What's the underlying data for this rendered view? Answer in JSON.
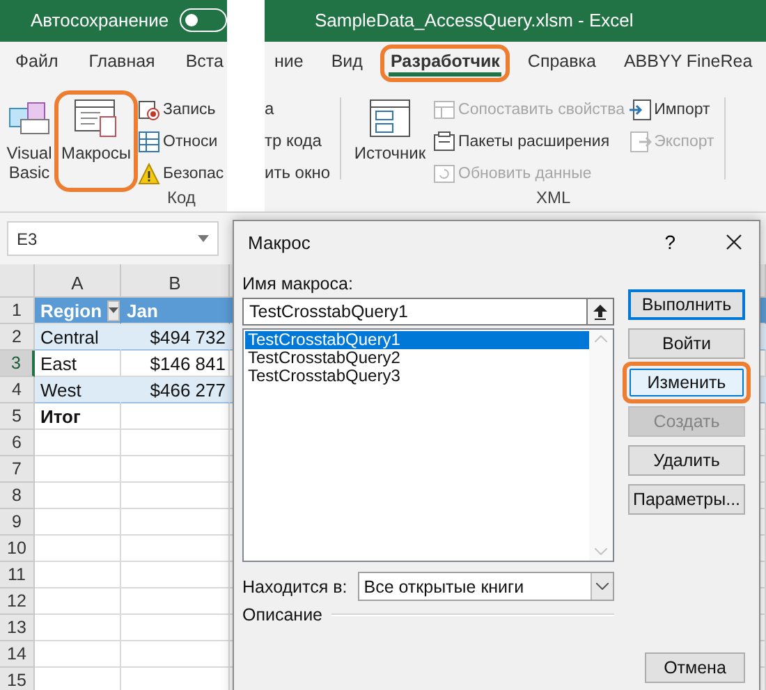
{
  "title_bar": {
    "autosave_label": "Автосохранение",
    "autosave_on": false,
    "title": "SampleData_AccessQuery.xlsm - Excel"
  },
  "tabs_left": [
    {
      "label": "Файл",
      "selected": false,
      "highlighted": false
    },
    {
      "label": "Главная",
      "selected": false,
      "highlighted": false
    },
    {
      "label": "Вста",
      "selected": false,
      "highlighted": false
    }
  ],
  "tabs_right": [
    {
      "label": "ние",
      "selected": false,
      "highlighted": false
    },
    {
      "label": "Вид",
      "selected": false,
      "highlighted": false
    },
    {
      "label": "Разработчик",
      "selected": true,
      "highlighted": true
    },
    {
      "label": "Справка",
      "selected": false,
      "highlighted": false
    },
    {
      "label": "ABBYY FineRea",
      "selected": false,
      "highlighted": false
    }
  ],
  "ribbon_left": {
    "large": [
      {
        "kind": "vb",
        "label": "Visual Basic",
        "highlighted": false
      },
      {
        "kind": "macros",
        "label": "Макросы",
        "highlighted": true
      }
    ],
    "small": [
      {
        "kind": "record",
        "label": "Запись"
      },
      {
        "kind": "relative",
        "label": "Относи"
      },
      {
        "kind": "security",
        "label": "Безопас"
      }
    ],
    "group_label": "Код"
  },
  "ribbon_right": {
    "fragments": [
      "а",
      "тр кода",
      "ить окно"
    ],
    "large": {
      "kind": "source",
      "label": "Источник"
    },
    "column_1": [
      {
        "kind": "map",
        "label": "Сопоставить свойства",
        "disabled": true
      },
      {
        "kind": "pack",
        "label": "Пакеты расширения",
        "disabled": false
      },
      {
        "kind": "refresh",
        "label": "Обновить данные",
        "disabled": true
      }
    ],
    "column_2": [
      {
        "kind": "import",
        "label": "Импорт",
        "disabled": false
      },
      {
        "kind": "export",
        "label": "Экспорт",
        "disabled": true
      }
    ],
    "group_label": "XML"
  },
  "sheet": {
    "name_box": "E3",
    "columns": [
      "A",
      "B"
    ],
    "rows": [
      {
        "number": "1",
        "selected": false,
        "kind": "header",
        "filter": true,
        "cells": [
          "Region",
          "Jan"
        ]
      },
      {
        "number": "2",
        "selected": false,
        "kind": "band",
        "cells": [
          "Central",
          "$494 732"
        ]
      },
      {
        "number": "3",
        "selected": true,
        "kind": "plain",
        "cells": [
          "East",
          "$146 841"
        ]
      },
      {
        "number": "4",
        "selected": false,
        "kind": "band",
        "cells": [
          "West",
          "$466 277"
        ]
      },
      {
        "number": "5",
        "selected": false,
        "kind": "total",
        "cells": [
          "Итог"
        ]
      },
      {
        "number": "6",
        "selected": false,
        "kind": "plain",
        "cells": []
      },
      {
        "number": "7",
        "selected": false,
        "kind": "plain",
        "cells": []
      },
      {
        "number": "8",
        "selected": false,
        "kind": "plain",
        "cells": []
      },
      {
        "number": "9",
        "selected": false,
        "kind": "plain",
        "cells": []
      },
      {
        "number": "10",
        "selected": false,
        "kind": "plain",
        "cells": []
      },
      {
        "number": "11",
        "selected": false,
        "kind": "plain",
        "cells": []
      },
      {
        "number": "12",
        "selected": false,
        "kind": "plain",
        "cells": []
      },
      {
        "number": "13",
        "selected": false,
        "kind": "plain",
        "cells": []
      },
      {
        "number": "14",
        "selected": false,
        "kind": "plain",
        "cells": []
      },
      {
        "number": "15",
        "selected": false,
        "kind": "plain",
        "cells": []
      }
    ]
  },
  "dialog": {
    "title": "Макрос",
    "help": "?",
    "name_label": "Имя макроса:",
    "name_value": "TestCrosstabQuery1",
    "macros": [
      {
        "label": "TestCrosstabQuery1",
        "selected": true
      },
      {
        "label": "TestCrosstabQuery2",
        "selected": false
      },
      {
        "label": "TestCrosstabQuery3",
        "selected": false
      }
    ],
    "location_label": "Находится в:",
    "location_value": "Все открытые книги",
    "description_label": "Описание",
    "buttons": [
      {
        "kind": "default",
        "label": "Выполнить",
        "disabled": false,
        "highlighted": false
      },
      {
        "kind": "normal",
        "label": "Войти",
        "disabled": false,
        "highlighted": false
      },
      {
        "kind": "normal",
        "label": "Изменить",
        "disabled": false,
        "highlighted": true
      },
      {
        "kind": "normal",
        "label": "Создать",
        "disabled": true,
        "highlighted": false
      },
      {
        "kind": "normal",
        "label": "Удалить",
        "disabled": false,
        "highlighted": false
      },
      {
        "kind": "normal",
        "label": "Параметры...",
        "disabled": false,
        "highlighted": false
      },
      {
        "kind": "cancel",
        "label": "Отмена",
        "disabled": false,
        "highlighted": false
      }
    ]
  }
}
